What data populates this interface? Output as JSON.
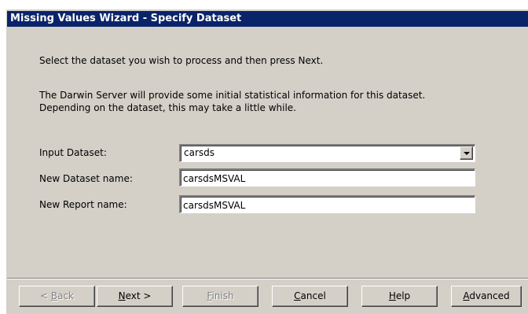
{
  "window": {
    "title": "Missing Values Wizard - Specify Dataset"
  },
  "instructions": {
    "line1": "Select the dataset you wish to process and then press Next.",
    "line2": "The Darwin Server will provide some initial statistical information for this dataset.",
    "line3": "Depending on the dataset, this may take a little while."
  },
  "form": {
    "input_dataset_label": "Input Dataset:",
    "input_dataset_value": "carsds",
    "new_dataset_label": "New Dataset name:",
    "new_dataset_value": "carsdsMSVAL",
    "new_report_label": "New Report name:",
    "new_report_value": "carsdsMSVAL"
  },
  "buttons": {
    "back": {
      "prefix": "< ",
      "accel": "B",
      "rest": "ack",
      "enabled": false
    },
    "next": {
      "prefix": "",
      "accel": "N",
      "rest": "ext >",
      "enabled": true
    },
    "finish": {
      "prefix": "",
      "accel": "F",
      "rest": "inish",
      "enabled": false
    },
    "cancel": {
      "prefix": "",
      "accel": "C",
      "rest": "ancel",
      "enabled": true
    },
    "help": {
      "prefix": "",
      "accel": "H",
      "rest": "elp",
      "enabled": true
    },
    "advanced": {
      "prefix": "",
      "accel": "A",
      "rest": "dvanced",
      "enabled": true
    }
  },
  "colors": {
    "titlebar": "#0a246a",
    "dialog_face": "#d4d0c8",
    "disabled_text": "#808080"
  },
  "icons": {
    "dropdown": "chevron-down-icon"
  }
}
